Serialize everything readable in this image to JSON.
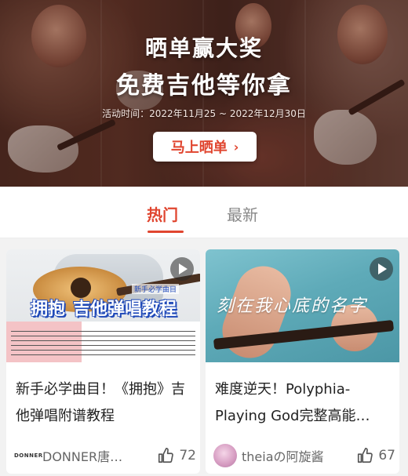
{
  "banner": {
    "title_line1": "晒单赢大奖",
    "title_line2": "免费吉他等你拿",
    "date_text": "活动时间：2022年11月25 ~ 2022年12月30日",
    "cta_label": "马上晒单"
  },
  "tabs": [
    {
      "label": "热门",
      "active": true
    },
    {
      "label": "最新",
      "active": false
    }
  ],
  "accent_color": "#e0452f",
  "cards": [
    {
      "thumb_overlay_parts": [
        "拥抱",
        "吉他弹唱教程"
      ],
      "thumb_small_label": "新手必学曲目",
      "title": "新手必学曲目！《拥抱》吉他弹唱附谱教程",
      "author": "DONNER唐…",
      "brand_logo": "DONNER",
      "likes": "72"
    },
    {
      "thumb_script": "刻在我心底的名字",
      "title": "难度逆天！Polyphia-Playing God完整高能…",
      "author": "theiaの阿旋酱",
      "likes": "67"
    }
  ],
  "icons": [
    "chevron-right-icon",
    "play-icon",
    "thumbs-up-icon"
  ]
}
